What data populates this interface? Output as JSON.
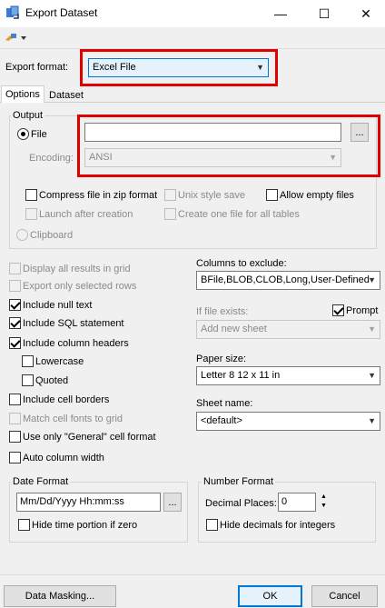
{
  "window": {
    "title": "Export Dataset",
    "minimize_glyph": "—",
    "maximize_glyph": "☐",
    "close_glyph": "✕"
  },
  "export_format": {
    "label": "Export format:",
    "value": "Excel File"
  },
  "tabs": [
    "Options",
    "Dataset"
  ],
  "output": {
    "title": "Output",
    "file_label": "File",
    "file_value": "",
    "browse_label": "...",
    "encoding_label": "Encoding:",
    "encoding_value": "ANSI",
    "compress_label": "Compress file in zip format",
    "unix_label": "Unix style save",
    "allow_empty_label": "Allow empty files",
    "launch_label": "Launch after creation",
    "one_file_label": "Create one file for all tables",
    "clipboard_label": "Clipboard"
  },
  "options": {
    "display_all": "Display all results in grid",
    "export_selected": "Export only selected rows",
    "include_null": "Include null text",
    "include_sql": "Include SQL statement",
    "include_headers": "Include column headers",
    "lowercase": "Lowercase",
    "quoted": "Quoted",
    "include_borders": "Include cell borders",
    "match_fonts": "Match cell fonts to grid",
    "use_general": "Use only \"General\" cell format",
    "auto_width": "Auto column width"
  },
  "right": {
    "columns_label": "Columns to exclude:",
    "columns_value": "BFile,BLOB,CLOB,Long,User-Defined",
    "if_exists_label": "If file exists:",
    "prompt_label": "Prompt",
    "if_exists_value": "Add new sheet",
    "paper_label": "Paper size:",
    "paper_value": "Letter 8 12 x 11 in",
    "sheet_label": "Sheet name:",
    "sheet_value": "<default>"
  },
  "date_format": {
    "title": "Date Format",
    "value": "Mm/Dd/Yyyy Hh:mm:ss",
    "browse_label": "...",
    "hide_time_label": "Hide time portion if zero"
  },
  "number_format": {
    "title": "Number Format",
    "decimal_label": "Decimal Places:",
    "decimal_value": "0",
    "hide_decimals_label": "Hide decimals for integers"
  },
  "footer": {
    "data_masking": "Data Masking...",
    "ok": "OK",
    "cancel": "Cancel"
  },
  "colors": {
    "highlight": "#e00000",
    "combo_focus_border": "#0078d7",
    "combo_focus_bg": "#e5f1fb"
  }
}
